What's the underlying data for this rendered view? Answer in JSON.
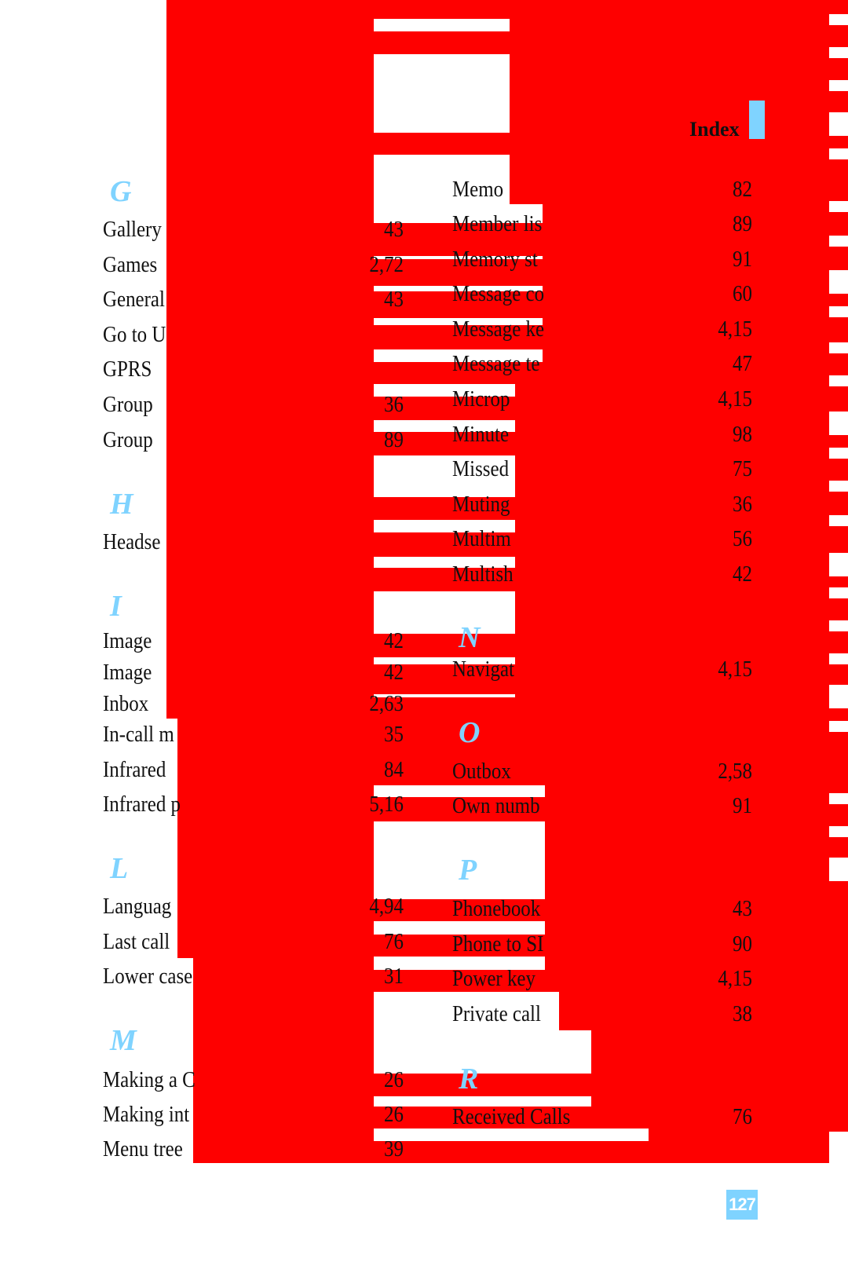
{
  "header": {
    "title": "Index",
    "accent_color": "#7fd3ff",
    "redaction_color": "#fe0000"
  },
  "page_number": "127",
  "left_column": [
    {
      "type": "letter",
      "text": "G"
    },
    {
      "type": "entry",
      "text": "Gallery",
      "page": "43"
    },
    {
      "type": "entry",
      "text": "Games",
      "page": "2,72"
    },
    {
      "type": "entry",
      "text": "General",
      "page": "43"
    },
    {
      "type": "entry",
      "text": "Go to U",
      "page": ""
    },
    {
      "type": "entry",
      "text": "GPRS",
      "page": ""
    },
    {
      "type": "entry",
      "text": "Group",
      "page": "36"
    },
    {
      "type": "entry",
      "text": "Group",
      "page": "89"
    },
    {
      "type": "letter",
      "text": "H"
    },
    {
      "type": "entry",
      "text": "Headse",
      "page": ""
    },
    {
      "type": "letter",
      "text": "I"
    },
    {
      "type": "entry",
      "text": "Image",
      "page": "42"
    },
    {
      "type": "entry",
      "text": "Image",
      "page": "42"
    },
    {
      "type": "entry",
      "text": "Inbox",
      "page": "2,63"
    },
    {
      "type": "entry",
      "text": "In-call m",
      "page": "35"
    },
    {
      "type": "entry",
      "text": "Infrared",
      "page": "84"
    },
    {
      "type": "entry",
      "text": "Infrared p",
      "page": "5,16"
    },
    {
      "type": "letter",
      "text": "L"
    },
    {
      "type": "entry",
      "text": "Languag",
      "page": "4,94"
    },
    {
      "type": "entry",
      "text": "Last call",
      "page": "76"
    },
    {
      "type": "entry",
      "text": "Lower case",
      "page": "31"
    },
    {
      "type": "letter",
      "text": "M"
    },
    {
      "type": "entry",
      "text": "Making a C",
      "page": "26"
    },
    {
      "type": "entry",
      "text": "Making int",
      "page": "26"
    },
    {
      "type": "entry",
      "text": "Menu tree",
      "page": "39"
    }
  ],
  "right_column": [
    {
      "type": "entry",
      "text": "Memo",
      "page": "82"
    },
    {
      "type": "entry",
      "text": "Member lis",
      "page": "89"
    },
    {
      "type": "entry",
      "text": "Memory st",
      "page": "91"
    },
    {
      "type": "entry",
      "text": "Message co",
      "page": "60"
    },
    {
      "type": "entry",
      "text": "Message ke",
      "page": "4,15"
    },
    {
      "type": "entry",
      "text": "Message te",
      "page": "47"
    },
    {
      "type": "entry",
      "text": "Microp",
      "page": "4,15"
    },
    {
      "type": "entry",
      "text": "Minute",
      "page": "98"
    },
    {
      "type": "entry",
      "text": "Missed",
      "page": "75"
    },
    {
      "type": "entry",
      "text": "Muting",
      "page": "36"
    },
    {
      "type": "entry",
      "text": "Multim",
      "page": "56"
    },
    {
      "type": "entry",
      "text": "Multish",
      "page": "42"
    },
    {
      "type": "letter",
      "text": "N"
    },
    {
      "type": "entry",
      "text": "Navigat",
      "page": "4,15"
    },
    {
      "type": "letter",
      "text": "O"
    },
    {
      "type": "entry",
      "text": "Outbox",
      "page": "2,58"
    },
    {
      "type": "entry",
      "text": "Own numb",
      "page": "91"
    },
    {
      "type": "letter",
      "text": "P"
    },
    {
      "type": "entry",
      "text": "Phonebook",
      "page": "43"
    },
    {
      "type": "entry",
      "text": "Phone to SI",
      "page": "90"
    },
    {
      "type": "entry",
      "text": "Power key",
      "page": "4,15"
    },
    {
      "type": "entry",
      "text": "Private call",
      "page": "38"
    },
    {
      "type": "letter",
      "text": "R"
    },
    {
      "type": "entry",
      "text": "Received Calls",
      "page": "76"
    }
  ]
}
